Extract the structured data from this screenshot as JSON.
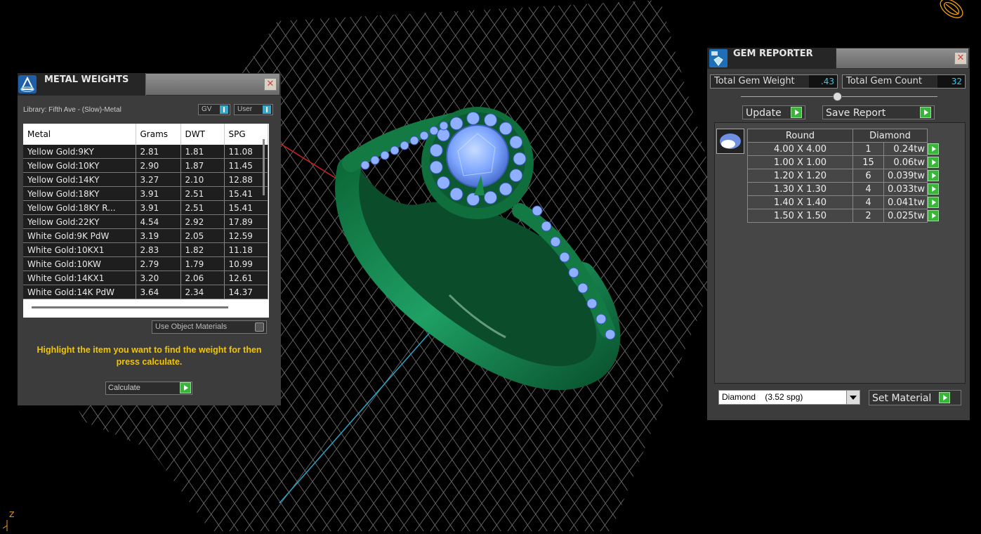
{
  "metal_weights": {
    "title": "METAL WEIGHTS",
    "library": "Library: Fifth Ave - (Slow)-Metal",
    "toggle_gv": "GV",
    "toggle_user": "User",
    "columns": [
      "Metal",
      "Grams",
      "DWT",
      "SPG"
    ],
    "rows": [
      [
        "Yellow Gold:9KY",
        "2.81",
        "1.81",
        "11.08"
      ],
      [
        "Yellow Gold:10KY",
        "2.90",
        "1.87",
        "11.45"
      ],
      [
        "Yellow Gold:14KY",
        "3.27",
        "2.10",
        "12.88"
      ],
      [
        "Yellow Gold:18KY",
        "3.91",
        "2.51",
        "15.41"
      ],
      [
        "Yellow Gold:18KY R...",
        "3.91",
        "2.51",
        "15.41"
      ],
      [
        "Yellow Gold:22KY",
        "4.54",
        "2.92",
        "17.89"
      ],
      [
        "White Gold:9K PdW",
        "3.19",
        "2.05",
        "12.59"
      ],
      [
        "White Gold:10KX1",
        "2.83",
        "1.82",
        "11.18"
      ],
      [
        "White Gold:10KW",
        "2.79",
        "1.79",
        "10.99"
      ],
      [
        "White Gold:14KX1",
        "3.20",
        "2.06",
        "12.61"
      ],
      [
        "White Gold:14K PdW",
        "3.64",
        "2.34",
        "14.37"
      ]
    ],
    "use_object_materials": "Use Object Materials",
    "hint": "Highlight the item you want to find the weight for then press calculate.",
    "calculate": "Calculate"
  },
  "gem_reporter": {
    "title": "GEM REPORTER",
    "total_weight_label": "Total Gem Weight",
    "total_weight_value": ".43",
    "total_count_label": "Total Gem Count",
    "total_count_value": "32",
    "update": "Update",
    "save_report": "Save Report",
    "shape_header": "Round",
    "material_header": "Diamond",
    "gems": [
      [
        "4.00 X 4.00",
        "1",
        "0.24tw"
      ],
      [
        "1.00 X 1.00",
        "15",
        "0.06tw"
      ],
      [
        "1.20 X 1.20",
        "6",
        "0.039tw"
      ],
      [
        "1.30 X 1.30",
        "4",
        "0.033tw"
      ],
      [
        "1.40 X 1.40",
        "4",
        "0.041tw"
      ],
      [
        "1.50 X 1.50",
        "2",
        "0.025tw"
      ]
    ],
    "material_select": "Diamond    (3.52 spg)",
    "set_material": "Set Material"
  },
  "axis_label": "Z",
  "icons": [
    "metal-weights-icon",
    "gem-reporter-icon",
    "close-icon",
    "play-icon",
    "gem-shape-icon",
    "gizmo-icon"
  ]
}
